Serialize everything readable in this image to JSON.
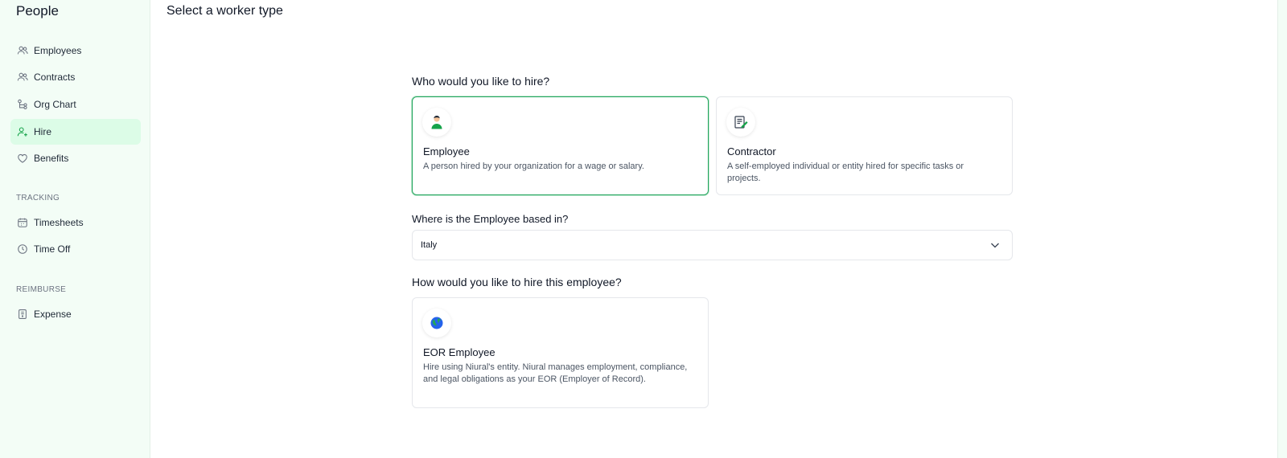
{
  "sidebar": {
    "title": "People",
    "items": [
      {
        "label": "Employees",
        "icon": "users-icon"
      },
      {
        "label": "Contracts",
        "icon": "users-icon"
      },
      {
        "label": "Org Chart",
        "icon": "org-chart-icon"
      },
      {
        "label": "Hire",
        "icon": "user-plus-icon",
        "active": true
      },
      {
        "label": "Benefits",
        "icon": "heart-icon"
      }
    ],
    "tracking_label": "TRACKING",
    "tracking_items": [
      {
        "label": "Timesheets",
        "icon": "calendar-icon"
      },
      {
        "label": "Time Off",
        "icon": "clock-icon"
      }
    ],
    "reimburse_label": "REIMBURSE",
    "reimburse_items": [
      {
        "label": "Expense",
        "icon": "receipt-icon"
      }
    ]
  },
  "main": {
    "title": "Select a worker type",
    "who_question": "Who would you like to hire?",
    "worker_types": [
      {
        "title": "Employee",
        "description": "A person hired by your organization for a wage or salary.",
        "icon": "person-icon",
        "selected": true
      },
      {
        "title": "Contractor",
        "description": "A self-employed individual or entity hired for specific tasks or projects.",
        "icon": "document-pen-icon",
        "selected": false
      }
    ],
    "location_question": "Where is the Employee based in?",
    "location_value": "Italy",
    "how_question": "How would you like to hire this employee?",
    "hire_methods": [
      {
        "title": "EOR Employee",
        "description": "Hire using Niural's entity. Niural manages employment, compliance, and legal obligations as your EOR (Employer of Record).",
        "icon": "globe-icon"
      }
    ]
  },
  "colors": {
    "accent": "#22a45d",
    "sidebar_bg": "#f3fdf6",
    "active_bg": "#dcfce7"
  }
}
